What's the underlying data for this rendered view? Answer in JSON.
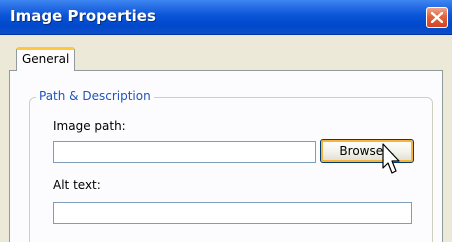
{
  "window": {
    "title": "Image Properties"
  },
  "tabs": [
    {
      "label": "General"
    }
  ],
  "group": {
    "legend": "Path & Description",
    "image_path": {
      "label": "Image path:",
      "value": "",
      "browse_label": "Browse..."
    },
    "alt_text": {
      "label": "Alt text:",
      "value": ""
    }
  },
  "colors": {
    "titlebar": "#0a55d8",
    "close_button": "#e3623c",
    "legend_text": "#2055b8",
    "tab_highlight": "#ffc83c",
    "button_focus": "#f8b33a"
  },
  "icons": {
    "close": "close-icon",
    "cursor": "mouse-pointer-icon"
  }
}
